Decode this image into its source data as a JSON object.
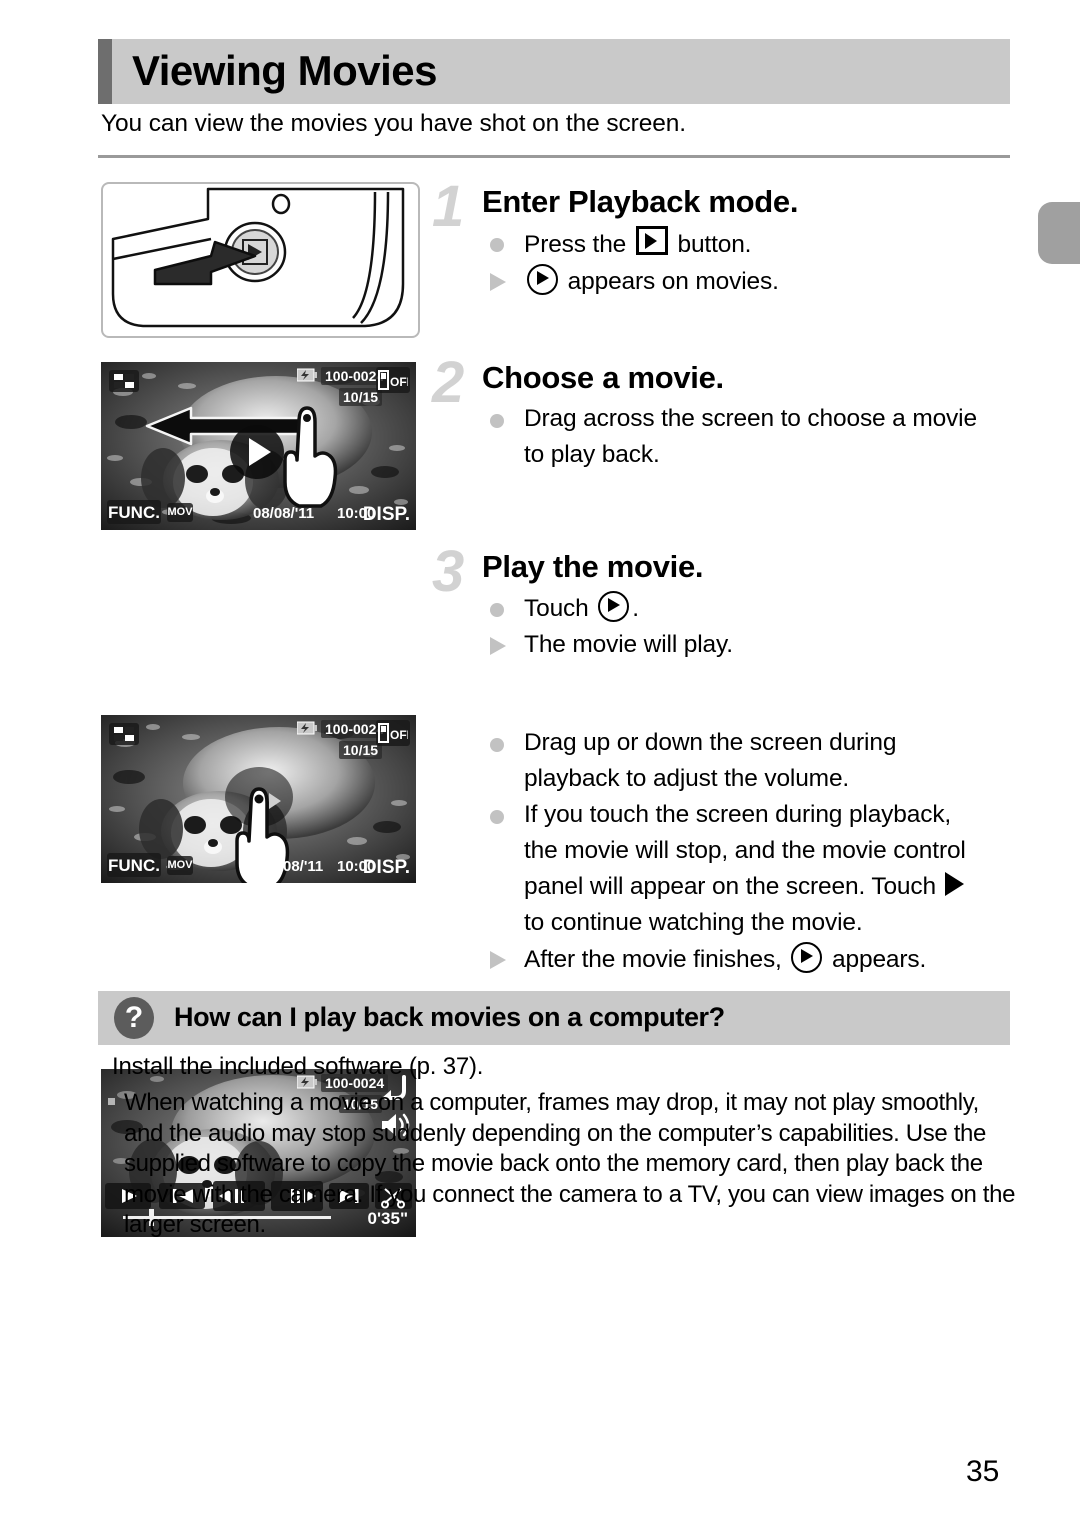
{
  "header": {
    "title": "Viewing Movies",
    "intro": "You can view the movies you have shot on the screen."
  },
  "steps": [
    {
      "number": "1",
      "heading": "Enter Playback mode.",
      "lines": [
        {
          "marker": "dot",
          "pre": "Press the ",
          "icon": "play-box-icon",
          "post": " button."
        },
        {
          "marker": "tri",
          "pre": "",
          "icon": "play-circle-icon",
          "post": " appears on movies."
        }
      ]
    },
    {
      "number": "2",
      "heading": "Choose a movie.",
      "lines": [
        {
          "marker": "dot",
          "pre": "Drag across the screen to choose a movie",
          "icon": "",
          "post": ""
        },
        {
          "marker": "none",
          "pre": "to play back.",
          "icon": "",
          "post": ""
        }
      ]
    },
    {
      "number": "3",
      "heading": "Play the movie.",
      "lines": [
        {
          "marker": "dot",
          "pre": "Touch ",
          "icon": "play-circle-icon",
          "post": "."
        },
        {
          "marker": "tri",
          "pre": "The movie will play.",
          "icon": "",
          "post": ""
        }
      ]
    }
  ],
  "notes": [
    {
      "marker": "dot",
      "pre": "Drag up or down the screen during",
      "icon": "",
      "post": ""
    },
    {
      "marker": "none",
      "pre": "playback to adjust the volume.",
      "icon": "",
      "post": ""
    },
    {
      "marker": "dot",
      "pre": "If you touch the screen during playback,",
      "icon": "",
      "post": ""
    },
    {
      "marker": "none",
      "pre": "the movie will stop, and the movie control",
      "icon": "",
      "post": ""
    },
    {
      "marker": "none",
      "pre": "panel will appear on the screen. Touch ",
      "icon": "triangle-play-icon",
      "post": ""
    },
    {
      "marker": "none",
      "pre": "to continue watching the movie.",
      "icon": "",
      "post": ""
    },
    {
      "marker": "tri",
      "pre": "After the movie finishes, ",
      "icon": "play-circle-icon",
      "post": " appears."
    }
  ],
  "qa": {
    "icon": "?",
    "question": "How can I play back movies on a computer?",
    "answer": "Install the included software (p. 37).",
    "note": "When watching a movie on a computer, frames may drop, it may not play smoothly, and the audio may stop suddenly depending on the computer’s capabilities. Use the supplied software to copy the movie back onto the memory card, then play back the movie with the camera. If you connect the camera to a TV, you can view images on the larger screen."
  },
  "figures": {
    "camera": {
      "label": "camera-back-playback-button",
      "button_icon": "play-icon"
    },
    "lcd_choose": {
      "index_icon": "index-view-icon",
      "battery_icon": "battery-icon",
      "file_number": "100-0024",
      "frame_counter": "10/15",
      "eco_label": "OFF",
      "func_label": "FUNC.",
      "movie_badge": "MOV",
      "date": "08/08/'11",
      "time": "10:00",
      "disp_label": "DISP.",
      "play_overlay_icon": "play-icon",
      "gesture_icon": "drag-left-hand-icon"
    },
    "lcd_touch": {
      "index_icon": "index-view-icon",
      "battery_icon": "battery-icon",
      "file_number": "100-0024",
      "frame_counter": "10/15",
      "eco_label": "OFF",
      "func_label": "FUNC.",
      "movie_badge": "MOV",
      "date": "08/'11",
      "time": "10:00",
      "disp_label": "DISP.",
      "gesture_icon": "tap-hand-icon"
    },
    "lcd_playback": {
      "battery_icon": "battery-icon",
      "file_number": "100-0024",
      "frame_counter": "10/15",
      "back_icon": "return-icon",
      "volume_icon": "speaker-icon",
      "elapsed": "0'35\"",
      "controls": [
        {
          "name": "play-button",
          "glyph": "play"
        },
        {
          "name": "previous-clip-button",
          "glyph": "prev"
        },
        {
          "name": "frame-back-button",
          "glyph": "frame-back"
        },
        {
          "name": "frame-forward-button",
          "glyph": "frame-fwd"
        },
        {
          "name": "next-clip-button",
          "glyph": "next"
        },
        {
          "name": "edit-scissors-button",
          "glyph": "scissors"
        }
      ]
    }
  },
  "footer": {
    "page_number": "35"
  },
  "colors": {
    "band": "#c9c9c9",
    "accent": "#6e6e6e",
    "marker": "#c2c2c2",
    "rule": "#9a9a9a"
  }
}
